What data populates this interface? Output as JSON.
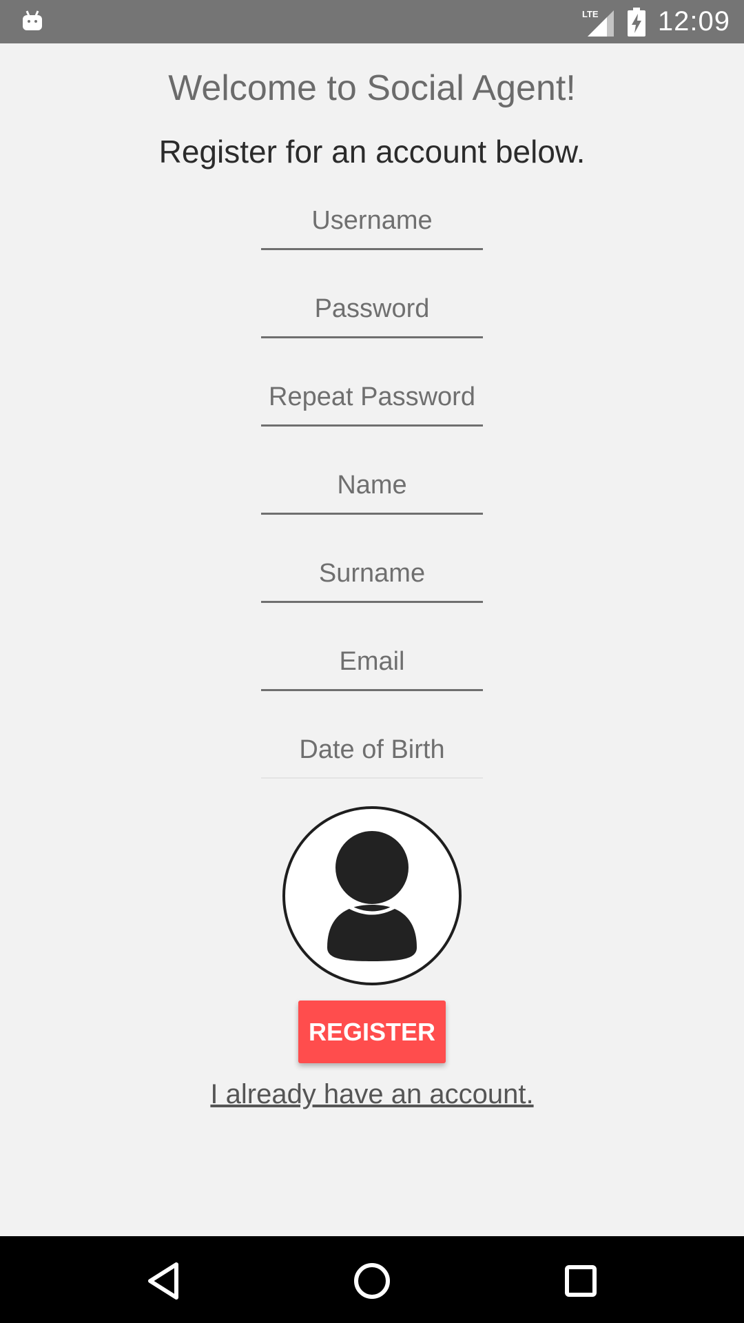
{
  "status_bar": {
    "network": "LTE",
    "time": "12:09"
  },
  "header": {
    "welcome": "Welcome to Social Agent!",
    "subtitle": "Register for an account below."
  },
  "form": {
    "username_placeholder": "Username",
    "password_placeholder": "Password",
    "repeat_password_placeholder": "Repeat Password",
    "name_placeholder": "Name",
    "surname_placeholder": "Surname",
    "email_placeholder": "Email",
    "dob_placeholder": "Date of Birth"
  },
  "actions": {
    "register_label": "REGISTER",
    "login_link": "I already have an account."
  },
  "colors": {
    "status_bar": "#757575",
    "background": "#f2f2f2",
    "register_button": "#ff4d4d",
    "nav_bar": "#000000"
  },
  "icons": {
    "status_left": "android-icon",
    "signal": "lte-signal-icon",
    "battery": "battery-charging-icon",
    "avatar": "user-avatar-icon",
    "nav_back": "back-icon",
    "nav_home": "home-icon",
    "nav_recents": "recents-icon"
  }
}
